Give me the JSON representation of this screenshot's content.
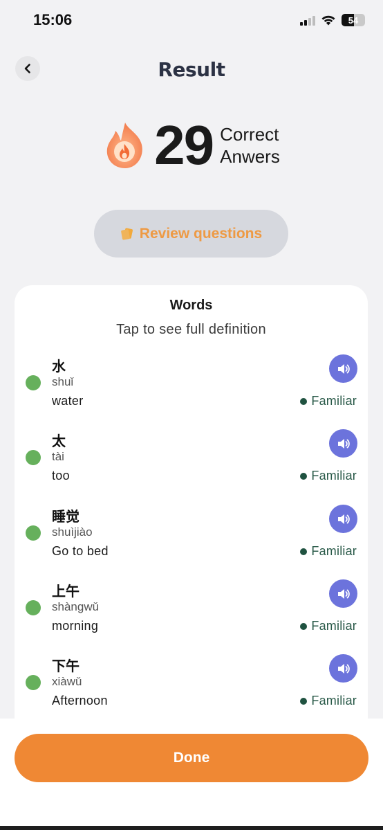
{
  "status_bar": {
    "time": "15:06",
    "battery": "54",
    "icons": [
      "signal-icon",
      "wifi-icon",
      "battery-icon"
    ]
  },
  "header": {
    "title": "Result",
    "back_icon": "chevron-left-icon"
  },
  "score": {
    "icon": "fire-icon",
    "value": "29",
    "caption_line1": "Correct",
    "caption_line2": "Anwers"
  },
  "review": {
    "label": "Review questions",
    "icon": "cards-icon"
  },
  "words": {
    "title": "Words",
    "subtitle": "Tap to see full definition",
    "items": [
      {
        "hanzi": "水",
        "pinyin": "shuǐ",
        "meaning": "water",
        "status": "Familiar"
      },
      {
        "hanzi": "太",
        "pinyin": "tài",
        "meaning": "too",
        "status": "Familiar"
      },
      {
        "hanzi": "睡觉",
        "pinyin": "shuìjiào",
        "meaning": "Go to bed",
        "status": "Familiar"
      },
      {
        "hanzi": "上午",
        "pinyin": "shàngwǔ",
        "meaning": "morning",
        "status": "Familiar"
      },
      {
        "hanzi": "下午",
        "pinyin": "xiàwǔ",
        "meaning": "Afternoon",
        "status": "Familiar"
      }
    ]
  },
  "done": {
    "label": "Done"
  },
  "colors": {
    "accent_orange": "#ef8834",
    "review_text": "#ee9a44",
    "audio_button": "#6c73dc",
    "familiar_green": "#1f5240",
    "status_dot": "#66b05c"
  }
}
